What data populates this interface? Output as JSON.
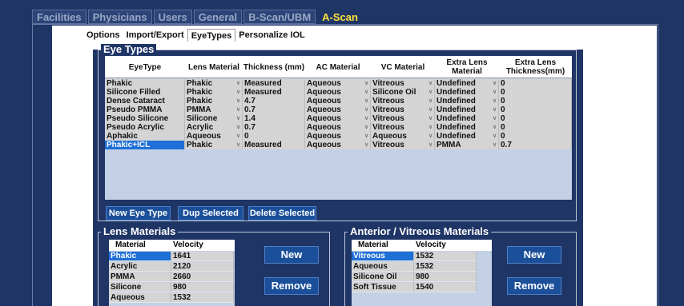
{
  "main_tabs": [
    "Facilities",
    "Physicians",
    "Users",
    "General",
    "B-Scan/UBM",
    "A-Scan"
  ],
  "sub_tabs": [
    "Options",
    "Import/Export",
    "EyeTypes",
    "Personalize IOL"
  ],
  "eye_types": {
    "title": "Eye Types",
    "columns": [
      "EyeType",
      "Lens Material",
      "Thickness (mm)",
      "AC Material",
      "VC Material",
      "Extra Lens Material",
      "Extra Lens Thickness(mm)"
    ],
    "rows": [
      {
        "eyetype": "Phakic",
        "lens": "Phakic",
        "thickness": "Measured",
        "ac": "Aqueous",
        "vc": "Vitreous",
        "extra_mat": "Undefined",
        "extra_thk": "0"
      },
      {
        "eyetype": "Silicone Filled",
        "lens": "Phakic",
        "thickness": "Measured",
        "ac": "Aqueous",
        "vc": "Silicone Oil",
        "extra_mat": "Undefined",
        "extra_thk": "0"
      },
      {
        "eyetype": "Dense Cataract",
        "lens": "Phakic",
        "thickness": "4.7",
        "ac": "Aqueous",
        "vc": "Vitreous",
        "extra_mat": "Undefined",
        "extra_thk": "0"
      },
      {
        "eyetype": "Pseudo PMMA",
        "lens": "PMMA",
        "thickness": "0.7",
        "ac": "Aqueous",
        "vc": "Vitreous",
        "extra_mat": "Undefined",
        "extra_thk": "0"
      },
      {
        "eyetype": "Pseudo Silicone",
        "lens": "Silicone",
        "thickness": "1.4",
        "ac": "Aqueous",
        "vc": "Vitreous",
        "extra_mat": "Undefined",
        "extra_thk": "0"
      },
      {
        "eyetype": "Pseudo Acrylic",
        "lens": "Acrylic",
        "thickness": "0.7",
        "ac": "Aqueous",
        "vc": "Vitreous",
        "extra_mat": "Undefined",
        "extra_thk": "0"
      },
      {
        "eyetype": "Aphakic",
        "lens": "Aqueous",
        "thickness": "0",
        "ac": "Aqueous",
        "vc": "Aqueous",
        "extra_mat": "Undefined",
        "extra_thk": "0"
      },
      {
        "eyetype": "Phakic+ICL",
        "lens": "Phakic",
        "thickness": "Measured",
        "ac": "Aqueous",
        "vc": "Vitreous",
        "extra_mat": "PMMA",
        "extra_thk": "0.7"
      }
    ],
    "selected_row": 7,
    "buttons": {
      "new": "New Eye Type",
      "dup": "Dup Selected",
      "delete": "Delete Selected"
    }
  },
  "lens_materials": {
    "title": "Lens Materials",
    "columns": [
      "Material",
      "Velocity"
    ],
    "rows": [
      {
        "material": "Phakic",
        "velocity": "1641"
      },
      {
        "material": "Acrylic",
        "velocity": "2120"
      },
      {
        "material": "PMMA",
        "velocity": "2660"
      },
      {
        "material": "Silicone",
        "velocity": "980"
      },
      {
        "material": "Aqueous",
        "velocity": "1532"
      }
    ],
    "buttons": {
      "new": "New",
      "remove": "Remove"
    }
  },
  "vitreous_materials": {
    "title": "Anterior / Vitreous Materials",
    "columns": [
      "Material",
      "Velocity"
    ],
    "rows": [
      {
        "material": "Vitreous",
        "velocity": "1532"
      },
      {
        "material": "Aqueous",
        "velocity": "1532"
      },
      {
        "material": "Silicone Oil",
        "velocity": "980"
      },
      {
        "material": "Soft Tissue",
        "velocity": "1540"
      }
    ],
    "buttons": {
      "new": "New",
      "remove": "Remove"
    }
  },
  "icons": {
    "dropdown": "chevron-down-icon"
  },
  "colors": {
    "background": "#1f3566",
    "active_tab": "#ffe33a",
    "selection": "#1e6fd6",
    "button": "#1b4f9a"
  }
}
